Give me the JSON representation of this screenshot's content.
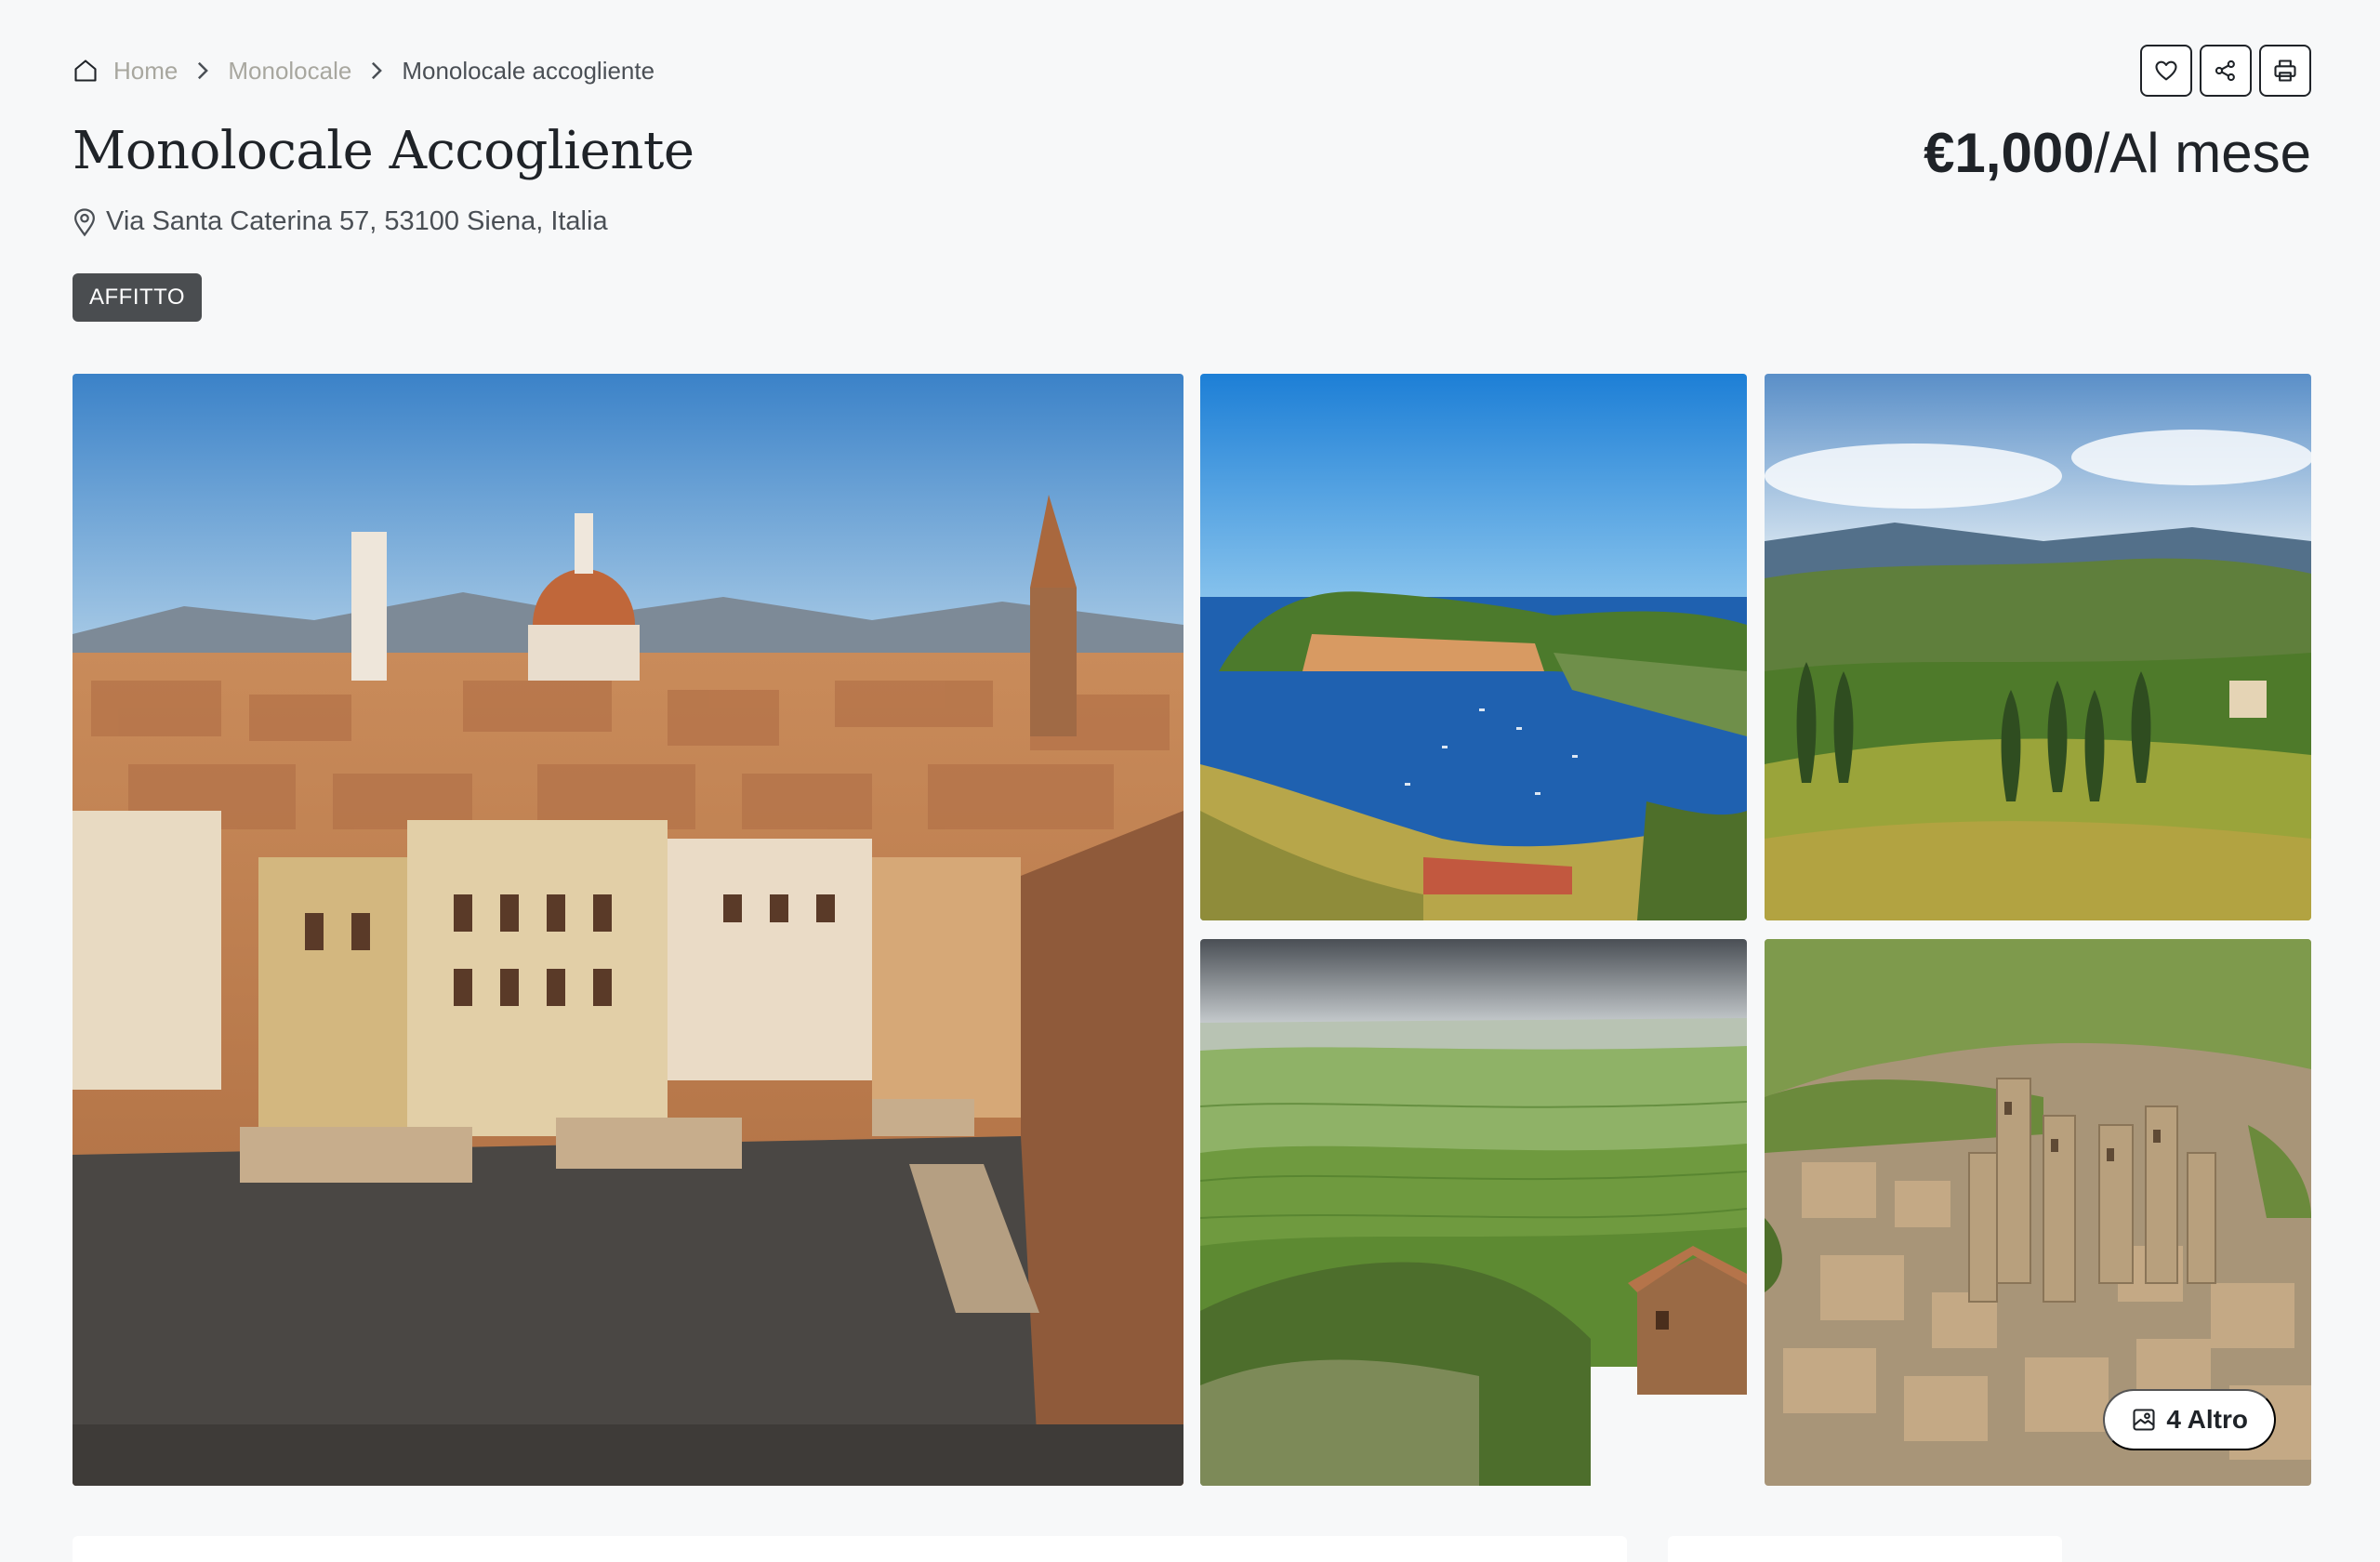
{
  "breadcrumb": {
    "home": "Home",
    "category": "Monolocale",
    "current": "Monolocale accogliente"
  },
  "actions": {
    "favorite_icon": "heart-icon",
    "share_icon": "share-icon",
    "print_icon": "printer-icon"
  },
  "listing": {
    "title": "Monolocale Accogliente",
    "address": "Via Santa Caterina 57, 53100 Siena, Italia",
    "status_badge": "AFFITTO",
    "price_amount": "€1,000",
    "price_period": "/Al mese"
  },
  "gallery": {
    "more_label": "4 Altro",
    "photos": [
      "florence-cityscape",
      "coastal-harbor",
      "tuscan-hills-cypress",
      "rolling-green-fields",
      "medieval-towers-town"
    ]
  },
  "colors": {
    "background": "#f7f8f9",
    "text": "#1f2328",
    "muted": "#a8a79f",
    "badge": "#4a4d50"
  }
}
